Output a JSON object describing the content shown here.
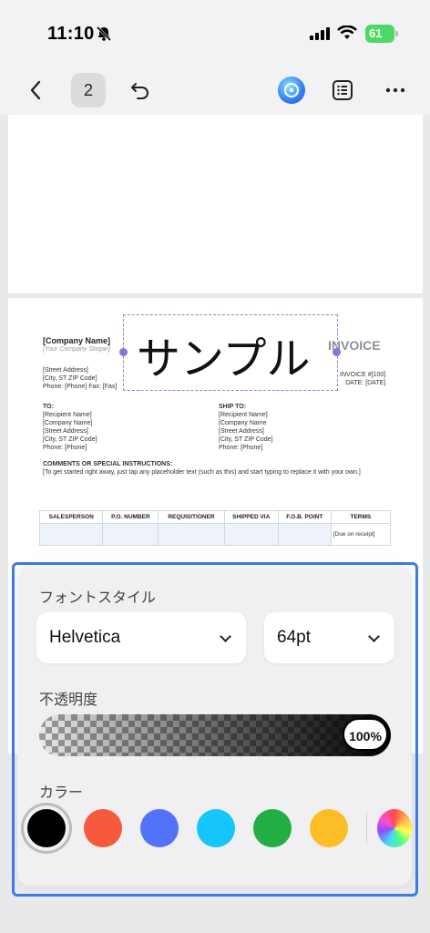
{
  "status": {
    "time": "11:10",
    "battery": "61"
  },
  "toolbar": {
    "page_count": "2"
  },
  "invoice": {
    "company_name": "[Company Name]",
    "slogan": "[Your Company Slogan]",
    "street": "[Street Address]",
    "city": "[City, ST ZIP Code]",
    "phone_fax": "Phone: [Phone]  Fax: [Fax]",
    "title": "INVOICE",
    "invoice_no": "INVOICE #[100]",
    "date": "DATE: [DATE]",
    "to_label": "TO:",
    "to_lines": [
      "[Recipient Name]",
      "[Company Name]",
      "[Street Address]",
      "[City, ST ZIP Code]",
      "Phone: [Phone]"
    ],
    "ship_label": "SHIP TO:",
    "ship_lines": [
      "[Recipient Name]",
      "[Company Name",
      "[Street Address]",
      "[City, ST ZIP Code]",
      "Phone: [Phone]"
    ],
    "comments_label": "COMMENTS OR SPECIAL INSTRUCTIONS:",
    "comments_text": "[To get started right away, just tap any placeholder text (such as this) and start typing to replace it with your own.]",
    "table_headers": [
      "SALESPERSON",
      "P.O. NUMBER",
      "REQUISITIONER",
      "SHIPPED VIA",
      "F.O.B. POINT",
      "TERMS"
    ],
    "terms_value": "[Due on receipt]"
  },
  "watermark": {
    "text": "サンプル"
  },
  "panel": {
    "font_style_label": "フォントスタイル",
    "font_family": "Helvetica",
    "font_size": "64pt",
    "opacity_label": "不透明度",
    "opacity_value": "100%",
    "color_label": "カラー"
  },
  "colors": [
    "#000000",
    "#f6593c",
    "#5272f8",
    "#14c6fb",
    "#22ae42",
    "#fcbe27"
  ],
  "selected_color": "#000000"
}
